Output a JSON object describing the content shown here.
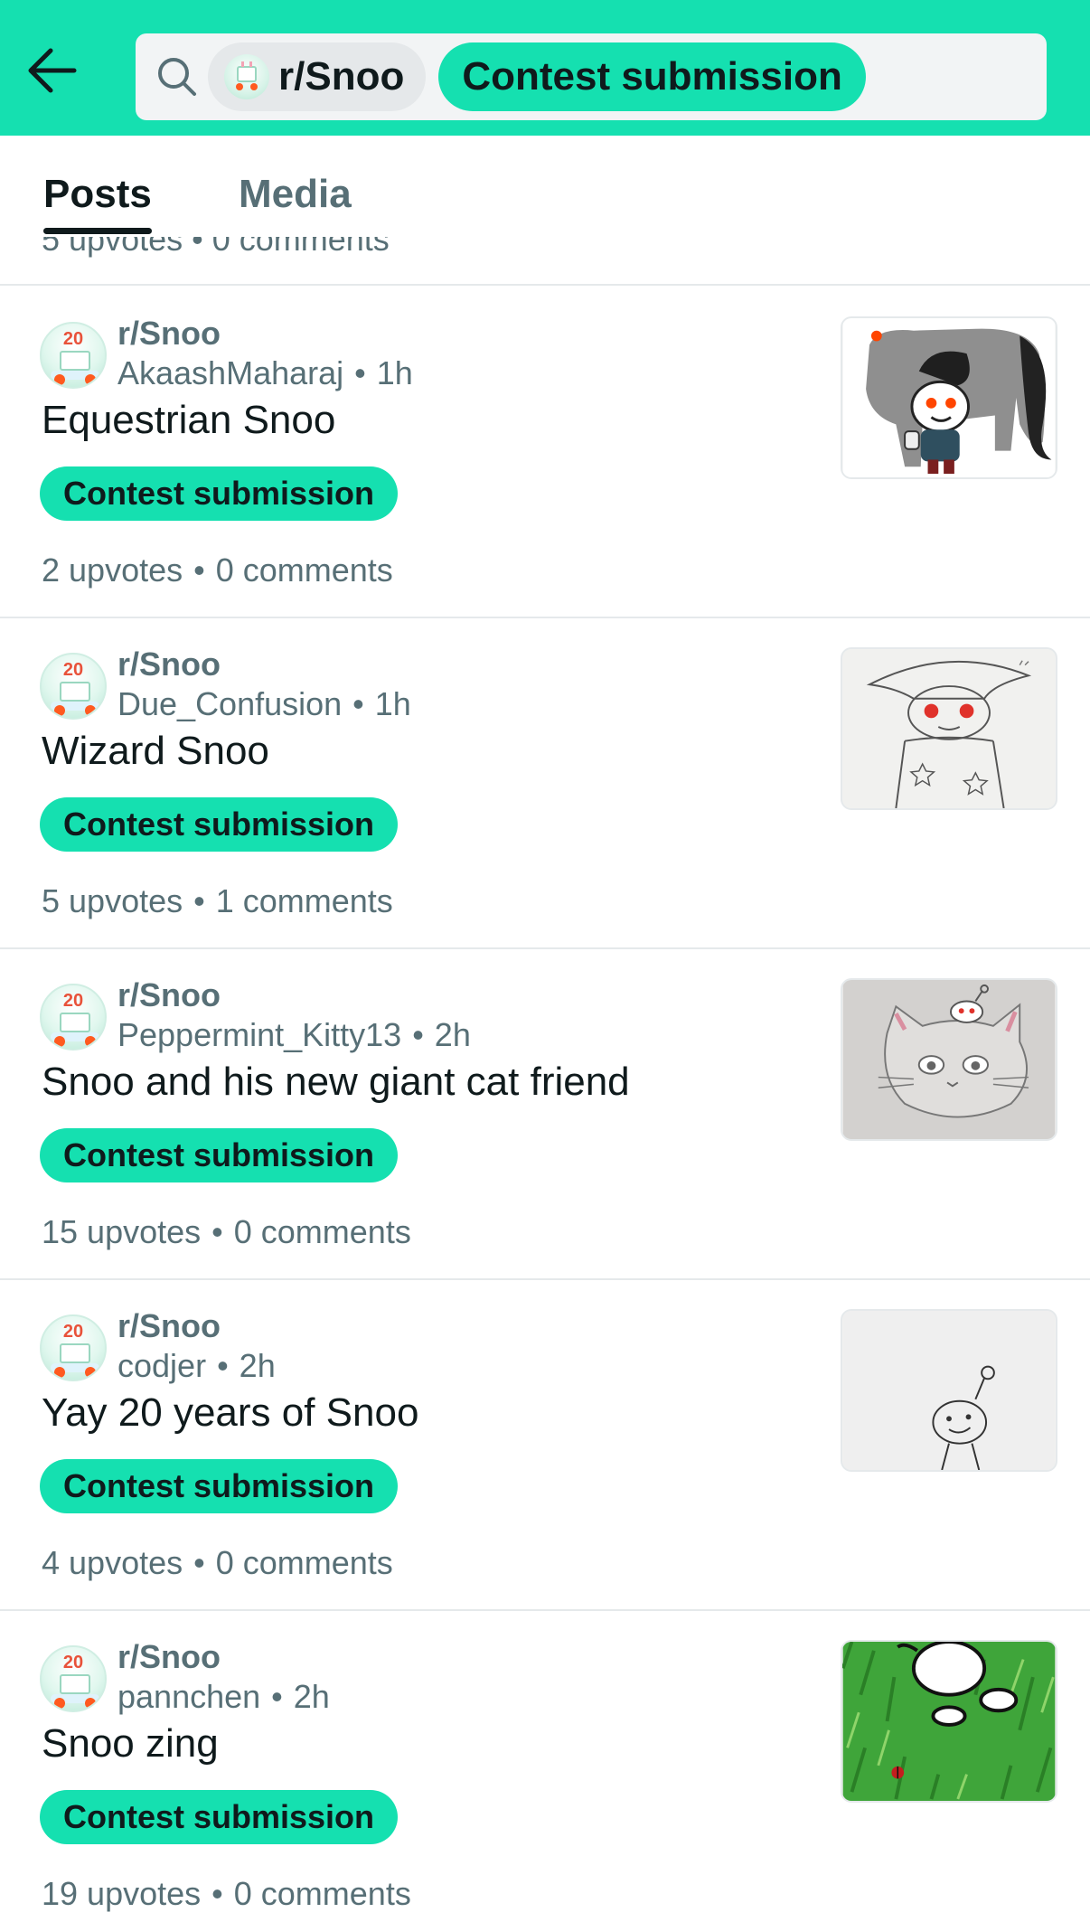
{
  "header": {
    "search": {
      "subreddit_chip": "r/Snoo",
      "flair_chip": "Contest submission"
    }
  },
  "tabs": [
    {
      "label": "Posts",
      "active": true
    },
    {
      "label": "Media",
      "active": false
    }
  ],
  "partial_post": {
    "stats": "5 upvotes • 0 comments"
  },
  "posts": [
    {
      "subreddit": "r/Snoo",
      "author": "AkaashMaharaj",
      "time": "1h",
      "title": "Equestrian Snoo",
      "flair": "Contest submission",
      "upvotes": "2 upvotes",
      "comments": "0 comments",
      "thumbnail": "equestrian-snoo-thumbnail"
    },
    {
      "subreddit": "r/Snoo",
      "author": "Due_Confusion",
      "time": "1h",
      "title": "Wizard Snoo",
      "flair": "Contest submission",
      "upvotes": "5 upvotes",
      "comments": "1 comments",
      "thumbnail": "wizard-snoo-thumbnail"
    },
    {
      "subreddit": "r/Snoo",
      "author": "Peppermint_Kitty13",
      "time": "2h",
      "title": "Snoo and his new giant cat friend",
      "flair": "Contest submission",
      "upvotes": "15 upvotes",
      "comments": "0 comments",
      "thumbnail": "cat-friend-thumbnail"
    },
    {
      "subreddit": "r/Snoo",
      "author": "codjer",
      "time": "2h",
      "title": "Yay 20 years of Snoo",
      "flair": "Contest submission",
      "upvotes": "4 upvotes",
      "comments": "0 comments",
      "thumbnail": "yay-20-years-thumbnail"
    },
    {
      "subreddit": "r/Snoo",
      "author": "pannchen",
      "time": "2h",
      "title": "Snoo zing",
      "flair": "Contest submission",
      "upvotes": "19 upvotes",
      "comments": "0 comments",
      "thumbnail": "snoo-zing-thumbnail"
    }
  ],
  "colors": {
    "accent": "#15e0b0",
    "text_primary": "#0f1a1c",
    "text_secondary": "#576f76",
    "divider": "#e5e9eb"
  },
  "icons": {
    "back": "back-arrow-icon",
    "search": "search-icon"
  },
  "meta_separator": "•",
  "avatar_text": "20"
}
